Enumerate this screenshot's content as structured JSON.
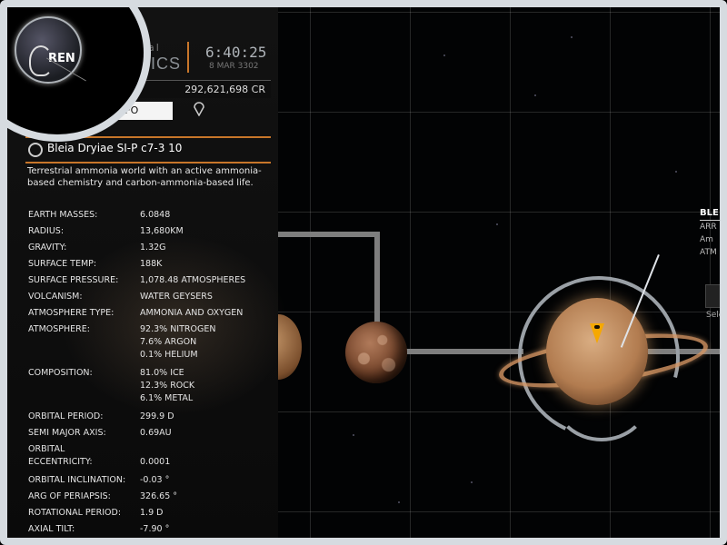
{
  "header": {
    "app_title_top": "ersal",
    "app_title_bottom": "APHICS",
    "time": "6:40:25",
    "date": "8 MAR 3302",
    "credits": "292,621,698 CR",
    "commander_badge": "REN"
  },
  "tabs": {
    "info_label": "INFO",
    "nav_icon": "location-pin-icon"
  },
  "body": {
    "name": "Bleia Dryiae SI-P c7-3 10",
    "description": "Terrestrial ammonia world with an active ammonia-based chemistry and carbon-ammonia-based life."
  },
  "properties": [
    {
      "label": "EARTH MASSES:",
      "value": "6.0848"
    },
    {
      "label": "RADIUS:",
      "value": "13,680KM"
    },
    {
      "label": "GRAVITY:",
      "value": "1.32G"
    },
    {
      "label": "SURFACE TEMP:",
      "value": "188K"
    },
    {
      "label": "SURFACE PRESSURE:",
      "value": "1,078.48 ATMOSPHERES"
    },
    {
      "label": "VOLCANISM:",
      "value": "WATER GEYSERS"
    },
    {
      "label": "ATMOSPHERE TYPE:",
      "value": "AMMONIA AND OXYGEN"
    },
    {
      "label": "ATMOSPHERE:",
      "value": "92.3% NITROGEN\n7.6% ARGON\n0.1% HELIUM"
    },
    {
      "label": "COMPOSITION:",
      "value": "81.0% ICE\n12.3% ROCK\n6.1% METAL"
    },
    {
      "label": "ORBITAL PERIOD:",
      "value": "299.9 D"
    },
    {
      "label": "SEMI MAJOR AXIS:",
      "value": "0.69AU"
    },
    {
      "label": "ORBITAL\nECCENTRICITY:",
      "value": "\n0.0001"
    },
    {
      "label": "ORBITAL INCLINATION:",
      "value": "-0.03 °"
    },
    {
      "label": "ARG OF PERIAPSIS:",
      "value": "326.65 °"
    },
    {
      "label": "ROTATIONAL PERIOD:",
      "value": "1.9 D"
    },
    {
      "label": "AXIAL TILT:",
      "value": "-7.90 °"
    }
  ],
  "callout": {
    "title": "BLE",
    "lines": [
      "ARR",
      "Am",
      "ATM"
    ],
    "select_label": "Sele"
  },
  "colors": {
    "accent": "#c8762a",
    "marker": "#f6a800"
  }
}
